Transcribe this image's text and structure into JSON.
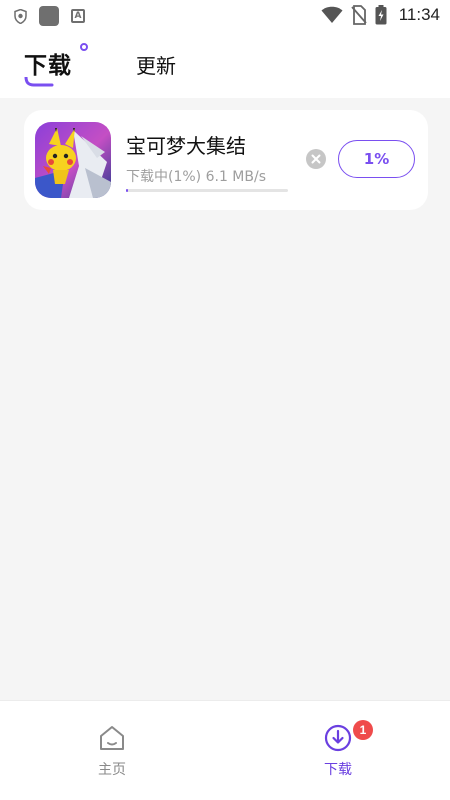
{
  "status_bar": {
    "time": "11:34",
    "icons": [
      "shield-icon",
      "app-square-icon",
      "font-a-icon",
      "wifi-icon",
      "no-sim-icon",
      "battery-charging-icon"
    ]
  },
  "header": {
    "tabs": [
      {
        "label": "下载",
        "active": true
      },
      {
        "label": "更新",
        "active": false
      }
    ]
  },
  "downloads": [
    {
      "name": "宝可梦大集结",
      "status_text": "下载中(1%) 6.1 MB/s",
      "progress": 0.01,
      "percent_label": "1%",
      "icon": "pokemon-unite-app-icon"
    }
  ],
  "bottom_nav": {
    "items": [
      {
        "label": "主页",
        "icon": "home-icon",
        "active": false
      },
      {
        "label": "下载",
        "icon": "download-icon",
        "active": true,
        "badge": "1"
      }
    ]
  },
  "colors": {
    "accent": "#7a4ff0",
    "badge": "#ef4b4b",
    "background": "#f5f5f5",
    "muted_text": "#9e9e9e"
  }
}
